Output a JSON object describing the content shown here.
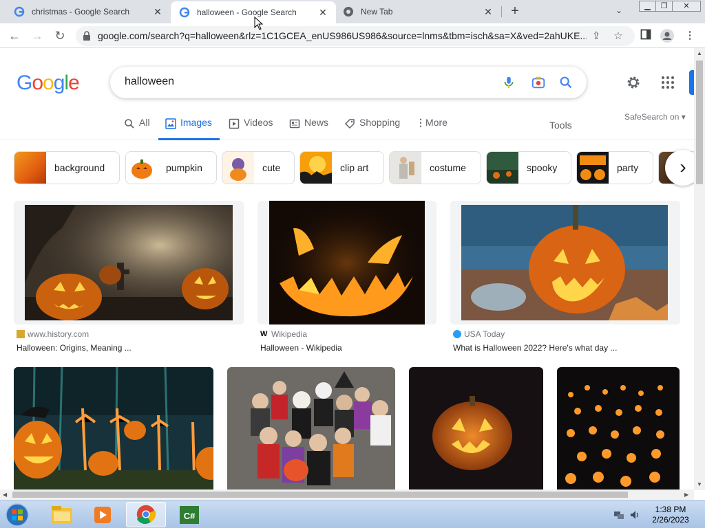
{
  "browser": {
    "tabs": [
      {
        "title": "christmas - Google Search",
        "active": false
      },
      {
        "title": "halloween - Google Search",
        "active": true
      },
      {
        "title": "New Tab",
        "active": false
      }
    ],
    "url": "google.com/search?q=halloween&rlz=1C1GCEA_enUS986US986&source=lnms&tbm=isch&sa=X&ved=2ahUKE..."
  },
  "search": {
    "query": "halloween"
  },
  "nav_tabs": [
    {
      "label": "All"
    },
    {
      "label": "Images"
    },
    {
      "label": "Videos"
    },
    {
      "label": "News"
    },
    {
      "label": "Shopping"
    },
    {
      "label": "More"
    }
  ],
  "tools_label": "Tools",
  "safesearch_label": "SafeSearch on",
  "chips": [
    {
      "label": "background"
    },
    {
      "label": "pumpkin"
    },
    {
      "label": "cute"
    },
    {
      "label": "clip art"
    },
    {
      "label": "costume"
    },
    {
      "label": "spooky"
    },
    {
      "label": "party"
    }
  ],
  "results": [
    {
      "source": "www.history.com",
      "caption": "Halloween: Origins, Meaning ..."
    },
    {
      "source": "Wikipedia",
      "caption": "Halloween - Wikipedia"
    },
    {
      "source": "USA Today",
      "caption": "What is Halloween 2022? Here's what day ..."
    },
    {
      "source": "",
      "caption": ""
    },
    {
      "source": "",
      "caption": ""
    },
    {
      "source": "",
      "caption": ""
    },
    {
      "source": "",
      "caption": ""
    }
  ],
  "taskbar": {
    "time": "1:38 PM",
    "date": "2/26/2023"
  },
  "colors": {
    "google_blue": "#4285F4",
    "google_red": "#EA4335",
    "google_yellow": "#FBBC05",
    "google_green": "#34A853",
    "active_tab": "#1a73e8"
  }
}
